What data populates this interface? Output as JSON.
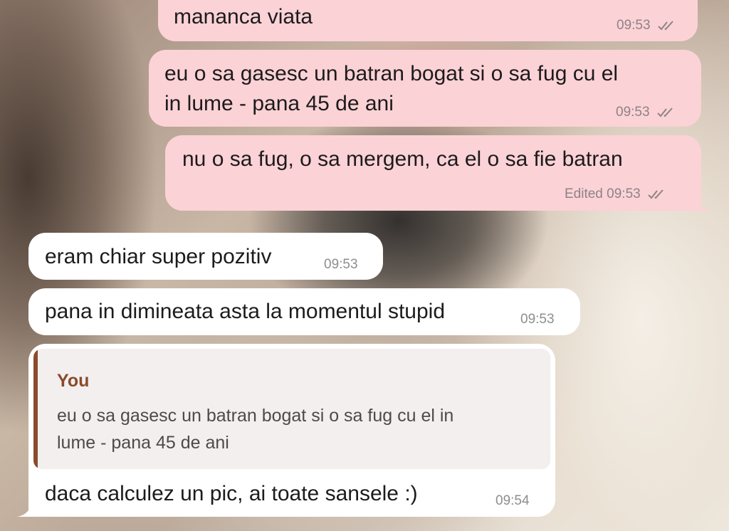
{
  "chat": {
    "messages": [
      {
        "direction": "outgoing",
        "text": "mananca viata",
        "time": "09:53",
        "status": "read"
      },
      {
        "direction": "outgoing",
        "lines": [
          "eu o sa gasesc un batran bogat si o sa fug cu el",
          "in lume - pana 45 de ani"
        ],
        "time": "09:53",
        "status": "read"
      },
      {
        "direction": "outgoing",
        "text": "nu o sa fug, o sa mergem, ca el o sa fie batran",
        "edited_label": "Edited",
        "time": "09:53",
        "status": "read"
      },
      {
        "direction": "incoming",
        "text": "eram chiar super pozitiv",
        "time": "09:53"
      },
      {
        "direction": "incoming",
        "text": "pana in dimineata asta la momentul stupid",
        "time": "09:53"
      },
      {
        "direction": "incoming",
        "reply": {
          "author": "You",
          "lines": [
            "eu o sa gasesc un batran bogat si o sa fug cu el in",
            "lume - pana 45 de ani"
          ]
        },
        "text": "daca calculez un pic, ai toate sansele :)",
        "time": "09:54"
      }
    ]
  },
  "icons": {
    "read_receipt": "double-check-icon"
  },
  "colors": {
    "outgoing_bubble": "#fbd2d6",
    "incoming_bubble": "#ffffff",
    "reply_accent": "#8a4b2c"
  }
}
